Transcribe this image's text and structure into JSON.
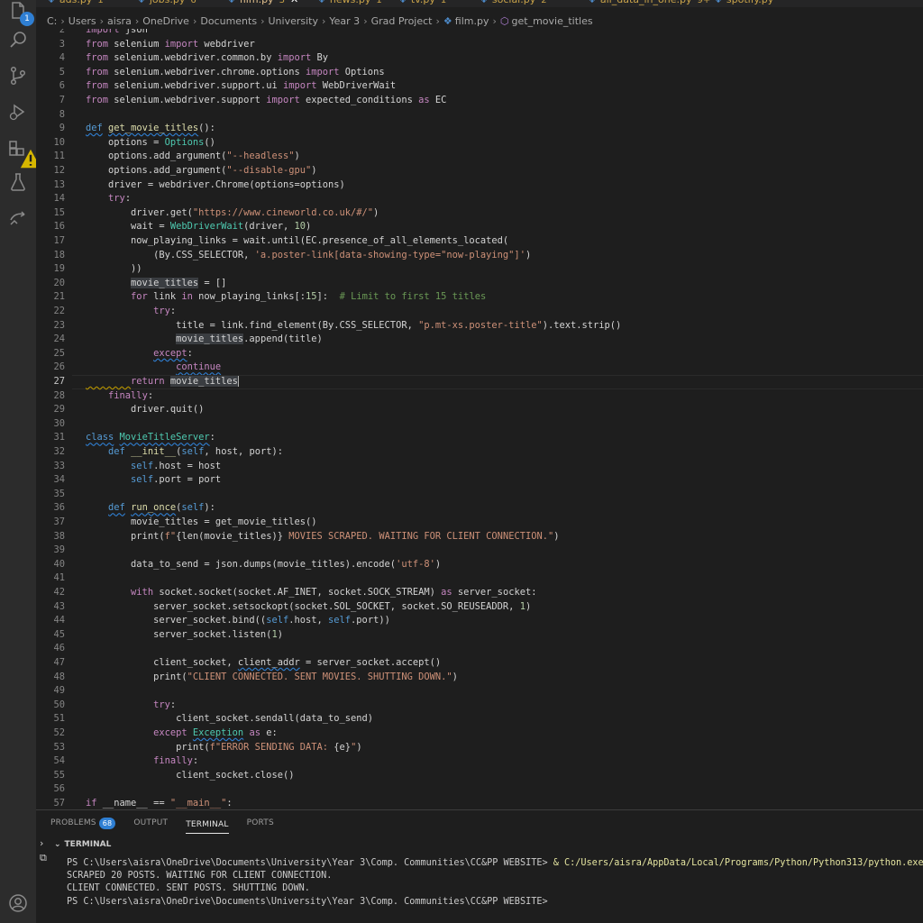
{
  "tabs": [
    {
      "label": "ads.py",
      "count": "1",
      "active": false
    },
    {
      "label": "jobs.py",
      "count": "6",
      "active": false
    },
    {
      "label": "film.py",
      "count": "3",
      "active": true
    },
    {
      "label": "news.py",
      "count": "1",
      "active": false
    },
    {
      "label": "tv.py",
      "count": "1",
      "active": false
    },
    {
      "label": "social.py",
      "count": "2",
      "active": false
    },
    {
      "label": "all_data_in_one.py",
      "count": "9+",
      "active": false
    },
    {
      "label": "spotify.py",
      "count": "",
      "active": false
    }
  ],
  "breadcrumb": [
    "C:",
    "Users",
    "aisra",
    "OneDrive",
    "Documents",
    "University",
    "Year 3",
    "Grad Project",
    "film.py",
    "get_movie_titles"
  ],
  "activity_bar": {
    "explorer_badge": "1"
  },
  "panel": {
    "tabs": [
      "PROBLEMS",
      "OUTPUT",
      "TERMINAL",
      "PORTS"
    ],
    "problems_count": "68",
    "terminal_title": "TERMINAL",
    "terminal_lines": [
      {
        "prompt": "PS C:\\Users\\aisra\\OneDrive\\Documents\\University\\Year 3\\Comp. Communities\\CC&PP WEBSITE> ",
        "cmd": "& C:/Users/aisra/AppData/Local/Programs/Python/Python313/python.exe"
      },
      {
        "prompt": "SCRAPED 20 POSTS. WAITING FOR CLIENT CONNECTION.",
        "cmd": ""
      },
      {
        "prompt": "CLIENT CONNECTED. SENT POSTS. SHUTTING DOWN.",
        "cmd": ""
      },
      {
        "prompt": "PS C:\\Users\\aisra\\OneDrive\\Documents\\University\\Year 3\\Comp. Communities\\CC&PP WEBSITE>",
        "cmd": ""
      }
    ]
  },
  "editor": {
    "current_line": 27,
    "lines": [
      {
        "n": 2,
        "t": [
          [
            "kw2",
            "import"
          ],
          [
            "p",
            " json"
          ]
        ]
      },
      {
        "n": 3,
        "t": [
          [
            "kw2",
            "from"
          ],
          [
            "p",
            " selenium "
          ],
          [
            "kw2",
            "import"
          ],
          [
            "p",
            " webdriver"
          ]
        ]
      },
      {
        "n": 4,
        "t": [
          [
            "kw2",
            "from"
          ],
          [
            "p",
            " selenium.webdriver.common.by "
          ],
          [
            "kw2",
            "import"
          ],
          [
            "p",
            " By"
          ]
        ]
      },
      {
        "n": 5,
        "t": [
          [
            "kw2",
            "from"
          ],
          [
            "p",
            " selenium.webdriver.chrome.options "
          ],
          [
            "kw2",
            "import"
          ],
          [
            "p",
            " Options"
          ]
        ]
      },
      {
        "n": 6,
        "t": [
          [
            "kw2",
            "from"
          ],
          [
            "p",
            " selenium.webdriver.support.ui "
          ],
          [
            "kw2",
            "import"
          ],
          [
            "p",
            " WebDriverWait"
          ]
        ]
      },
      {
        "n": 7,
        "t": [
          [
            "kw2",
            "from"
          ],
          [
            "p",
            " selenium.webdriver.support "
          ],
          [
            "kw2",
            "import"
          ],
          [
            "p",
            " expected_conditions "
          ],
          [
            "kw2",
            "as"
          ],
          [
            "p",
            " EC"
          ]
        ]
      },
      {
        "n": 8,
        "t": []
      },
      {
        "n": 9,
        "t": [
          [
            "kw sq",
            "def"
          ],
          [
            "p",
            " "
          ],
          [
            "fn sq",
            "get_movie_titles"
          ],
          [
            "p",
            "():"
          ]
        ]
      },
      {
        "n": 10,
        "t": [
          [
            "p",
            "    options = "
          ],
          [
            "cls",
            "Options"
          ],
          [
            "p",
            "()"
          ]
        ]
      },
      {
        "n": 11,
        "t": [
          [
            "p",
            "    options.add_argument("
          ],
          [
            "str",
            "\"--headless\""
          ],
          [
            "p",
            ")"
          ]
        ]
      },
      {
        "n": 12,
        "t": [
          [
            "p",
            "    options.add_argument("
          ],
          [
            "str",
            "\"--disable-gpu\""
          ],
          [
            "p",
            ")"
          ]
        ]
      },
      {
        "n": 13,
        "t": [
          [
            "p",
            "    driver = webdriver.Chrome(options=options)"
          ]
        ]
      },
      {
        "n": 14,
        "t": [
          [
            "p",
            "    "
          ],
          [
            "kw2",
            "try"
          ],
          [
            "p",
            ":"
          ]
        ]
      },
      {
        "n": 15,
        "t": [
          [
            "p",
            "        driver.get("
          ],
          [
            "str",
            "\"https://www.cineworld.co.uk/#/\""
          ],
          [
            "p",
            ")"
          ]
        ]
      },
      {
        "n": 16,
        "t": [
          [
            "p",
            "        wait = "
          ],
          [
            "cls",
            "WebDriverWait"
          ],
          [
            "p",
            "(driver, "
          ],
          [
            "num",
            "10"
          ],
          [
            "p",
            ")"
          ]
        ]
      },
      {
        "n": 17,
        "t": [
          [
            "p",
            "        now_playing_links = wait.until(EC.presence_of_all_elements_located("
          ]
        ]
      },
      {
        "n": 18,
        "t": [
          [
            "p",
            "            (By.CSS_SELECTOR, "
          ],
          [
            "str",
            "'a.poster-link[data-showing-type=\"now-playing\"]'"
          ],
          [
            "p",
            ")"
          ]
        ]
      },
      {
        "n": 19,
        "t": [
          [
            "p",
            "        ))"
          ]
        ]
      },
      {
        "n": 20,
        "t": [
          [
            "p",
            "        "
          ],
          [
            "p hl",
            "movie_titles"
          ],
          [
            "p",
            " = []"
          ]
        ]
      },
      {
        "n": 21,
        "t": [
          [
            "p",
            "        "
          ],
          [
            "kw2",
            "for"
          ],
          [
            "p",
            " link "
          ],
          [
            "kw2",
            "in"
          ],
          [
            "p",
            " now_playing_links[:"
          ],
          [
            "num",
            "15"
          ],
          [
            "p",
            "]:  "
          ],
          [
            "cmt",
            "# Limit to first 15 titles"
          ]
        ]
      },
      {
        "n": 22,
        "t": [
          [
            "p",
            "            "
          ],
          [
            "kw2",
            "try"
          ],
          [
            "p",
            ":"
          ]
        ]
      },
      {
        "n": 23,
        "t": [
          [
            "p",
            "                title = link.find_element(By.CSS_SELECTOR, "
          ],
          [
            "str",
            "\"p.mt-xs.poster-title\""
          ],
          [
            "p",
            ").text.strip()"
          ]
        ]
      },
      {
        "n": 24,
        "t": [
          [
            "p",
            "                "
          ],
          [
            "p hl",
            "movie_titles"
          ],
          [
            "p",
            ".append(title)"
          ]
        ]
      },
      {
        "n": 25,
        "t": [
          [
            "p",
            "            "
          ],
          [
            "kw2 sq",
            "except"
          ],
          [
            "p",
            ":"
          ]
        ]
      },
      {
        "n": 26,
        "t": [
          [
            "p",
            "                "
          ],
          [
            "kw2 sq",
            "continue"
          ]
        ]
      },
      {
        "n": 27,
        "t": [
          [
            "p sqy",
            "        "
          ],
          [
            "kw2",
            "return"
          ],
          [
            "p",
            " "
          ],
          [
            "p hl",
            "movie_titles"
          ]
        ]
      },
      {
        "n": 28,
        "t": [
          [
            "p",
            "    "
          ],
          [
            "kw2",
            "finally"
          ],
          [
            "p",
            ":"
          ]
        ]
      },
      {
        "n": 29,
        "t": [
          [
            "p",
            "        driver.quit()"
          ]
        ]
      },
      {
        "n": 30,
        "t": []
      },
      {
        "n": 31,
        "t": [
          [
            "kw sq",
            "class"
          ],
          [
            "p",
            " "
          ],
          [
            "cls sq",
            "MovieTitleServer"
          ],
          [
            "p",
            ":"
          ]
        ]
      },
      {
        "n": 32,
        "t": [
          [
            "p",
            "    "
          ],
          [
            "kw",
            "def"
          ],
          [
            "p",
            " "
          ],
          [
            "fn",
            "__init__"
          ],
          [
            "p",
            "("
          ],
          [
            "slf",
            "self"
          ],
          [
            "p",
            ", host, port):"
          ]
        ]
      },
      {
        "n": 33,
        "t": [
          [
            "p",
            "        "
          ],
          [
            "slf",
            "self"
          ],
          [
            "p",
            ".host = host"
          ]
        ]
      },
      {
        "n": 34,
        "t": [
          [
            "p",
            "        "
          ],
          [
            "slf",
            "self"
          ],
          [
            "p",
            ".port = port"
          ]
        ]
      },
      {
        "n": 35,
        "t": []
      },
      {
        "n": 36,
        "t": [
          [
            "p",
            "    "
          ],
          [
            "kw sq",
            "def"
          ],
          [
            "p",
            " "
          ],
          [
            "fn sq",
            "run_once"
          ],
          [
            "p",
            "("
          ],
          [
            "slf",
            "self"
          ],
          [
            "p",
            "):"
          ]
        ]
      },
      {
        "n": 37,
        "t": [
          [
            "p",
            "        movie_titles = get_movie_titles()"
          ]
        ]
      },
      {
        "n": 38,
        "t": [
          [
            "p",
            "        print("
          ],
          [
            "str",
            "f\""
          ],
          [
            "p",
            "{len(movie_titles)}"
          ],
          [
            "str",
            " MOVIES SCRAPED. WAITING FOR CLIENT CONNECTION.\""
          ],
          [
            "p",
            ")"
          ]
        ]
      },
      {
        "n": 39,
        "t": []
      },
      {
        "n": 40,
        "t": [
          [
            "p",
            "        data_to_send = json.dumps(movie_titles).encode("
          ],
          [
            "str",
            "'utf-8'"
          ],
          [
            "p",
            ")"
          ]
        ]
      },
      {
        "n": 41,
        "t": []
      },
      {
        "n": 42,
        "t": [
          [
            "p",
            "        "
          ],
          [
            "kw2",
            "with"
          ],
          [
            "p",
            " socket.socket(socket.AF_INET, socket.SOCK_STREAM) "
          ],
          [
            "kw2",
            "as"
          ],
          [
            "p",
            " server_socket:"
          ]
        ]
      },
      {
        "n": 43,
        "t": [
          [
            "p",
            "            server_socket.setsockopt(socket.SOL_SOCKET, socket.SO_REUSEADDR, "
          ],
          [
            "num",
            "1"
          ],
          [
            "p",
            ")"
          ]
        ]
      },
      {
        "n": 44,
        "t": [
          [
            "p",
            "            server_socket.bind(("
          ],
          [
            "slf",
            "self"
          ],
          [
            "p",
            ".host, "
          ],
          [
            "slf",
            "self"
          ],
          [
            "p",
            ".port))"
          ]
        ]
      },
      {
        "n": 45,
        "t": [
          [
            "p",
            "            server_socket.listen("
          ],
          [
            "num",
            "1"
          ],
          [
            "p",
            ")"
          ]
        ]
      },
      {
        "n": 46,
        "t": []
      },
      {
        "n": 47,
        "t": [
          [
            "p",
            "            client_socket, "
          ],
          [
            "p sq",
            "client_addr"
          ],
          [
            "p",
            " = server_socket.accept()"
          ]
        ]
      },
      {
        "n": 48,
        "t": [
          [
            "p",
            "            print("
          ],
          [
            "str",
            "\"CLIENT CONNECTED. SENT MOVIES. SHUTTING DOWN.\""
          ],
          [
            "p",
            ")"
          ]
        ]
      },
      {
        "n": 49,
        "t": []
      },
      {
        "n": 50,
        "t": [
          [
            "p",
            "            "
          ],
          [
            "kw2",
            "try"
          ],
          [
            "p",
            ":"
          ]
        ]
      },
      {
        "n": 51,
        "t": [
          [
            "p",
            "                client_socket.sendall(data_to_send)"
          ]
        ]
      },
      {
        "n": 52,
        "t": [
          [
            "p",
            "            "
          ],
          [
            "kw2",
            "except"
          ],
          [
            "p",
            " "
          ],
          [
            "cls sq",
            "Exception"
          ],
          [
            "p",
            " "
          ],
          [
            "kw2",
            "as"
          ],
          [
            "p",
            " e:"
          ]
        ]
      },
      {
        "n": 53,
        "t": [
          [
            "p",
            "                print("
          ],
          [
            "str",
            "f\"ERROR SENDING DATA: "
          ],
          [
            "p",
            "{e}"
          ],
          [
            "str",
            "\""
          ],
          [
            "p",
            ")"
          ]
        ]
      },
      {
        "n": 54,
        "t": [
          [
            "p",
            "            "
          ],
          [
            "kw2",
            "finally"
          ],
          [
            "p",
            ":"
          ]
        ]
      },
      {
        "n": 55,
        "t": [
          [
            "p",
            "                client_socket.close()"
          ]
        ]
      },
      {
        "n": 56,
        "t": []
      },
      {
        "n": 57,
        "t": [
          [
            "kw2",
            "if"
          ],
          [
            "p",
            " __name__ == "
          ],
          [
            "str",
            "\"__main__\""
          ],
          [
            "p",
            ":"
          ]
        ]
      }
    ]
  },
  "colors": {
    "editor_bg": "#1e1e1e",
    "activity_bg": "#2c2c2c",
    "accent": "#2f7fd3",
    "keyword": "#569cd6",
    "control": "#c586c0",
    "string": "#ce9178",
    "function": "#dcdcaa",
    "class": "#4ec9b0"
  },
  "icons": [
    "files-icon",
    "search-icon",
    "source-control-icon",
    "run-debug-icon",
    "extensions-icon",
    "testing-icon",
    "remote-icon",
    "account-icon"
  ]
}
